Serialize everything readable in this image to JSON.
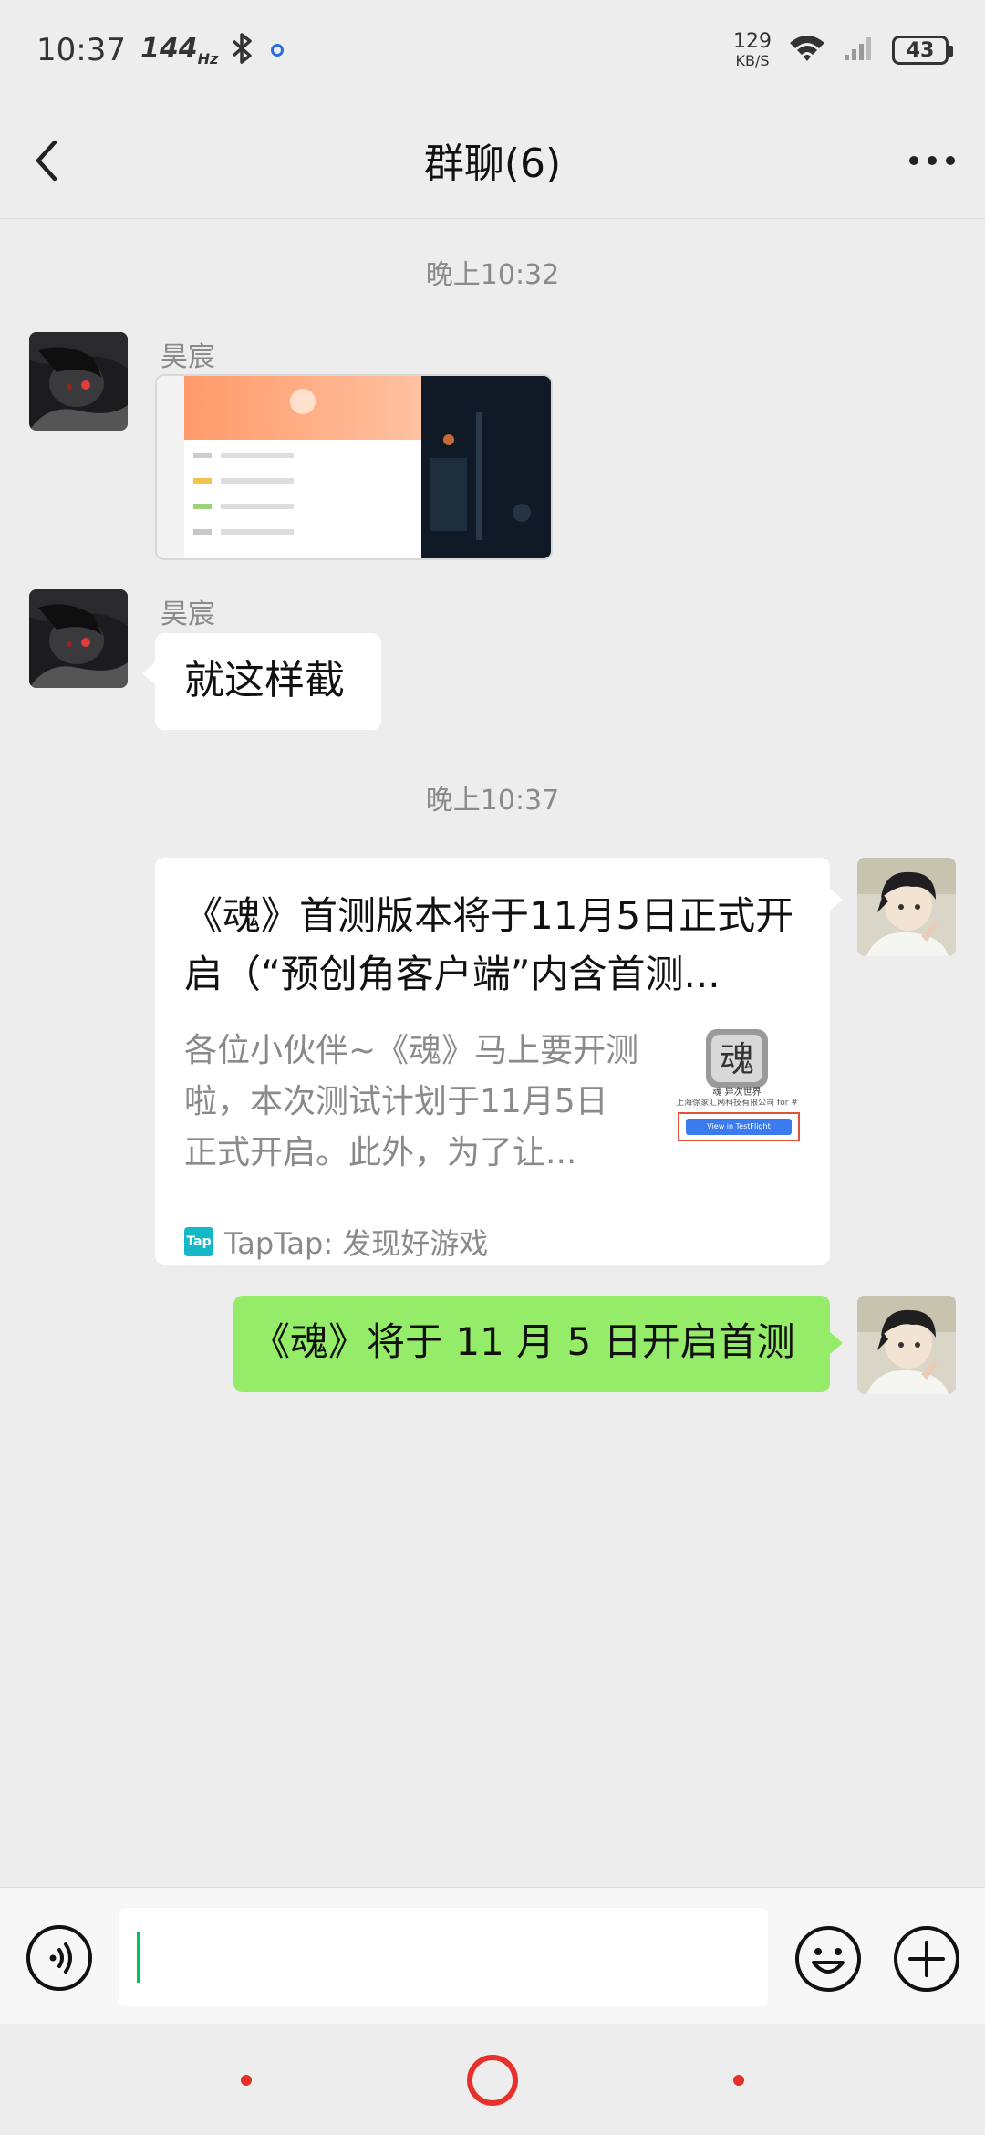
{
  "status_bar": {
    "time": "10:37",
    "refresh_rate": "144",
    "refresh_unit": "Hz",
    "net_speed_value": "129",
    "net_speed_unit": "KB/S",
    "battery": "43"
  },
  "header": {
    "title": "群聊(6)"
  },
  "messages": {
    "time_1": "晚上10:32",
    "sender_1": "昊宸",
    "sender_2": "昊宸",
    "text_1": "就这样截",
    "time_2": "晚上10:37",
    "card": {
      "title": "《魂》首测版本将于11月5日正式开启（“预创角客户端”内含首测...",
      "description": "各位小伙伴~《魂》马上要开测啦，本次测试计划于11月5日正式开启。此外，为了让...",
      "thumb_line1": "魂 异次世界",
      "thumb_line2": "上海徐家汇网科技有限公司 for #",
      "thumb_button": "View in TestFlight",
      "source_logo": "Tap",
      "source": "TapTap: 发现好游戏"
    },
    "text_2": "《魂》将于 11 月 5 日开启首测"
  },
  "input_bar": {
    "value": ""
  },
  "colors": {
    "background": "#ededed",
    "bubble_green": "#95ec69",
    "bubble_white": "#ffffff",
    "caret": "#07c160",
    "nav_accent": "#e8302a"
  },
  "icons": {
    "back": "chevron-left-icon",
    "more": "more-dots-icon",
    "voice": "voice-icon",
    "emoji": "emoji-icon",
    "plus": "plus-icon"
  }
}
